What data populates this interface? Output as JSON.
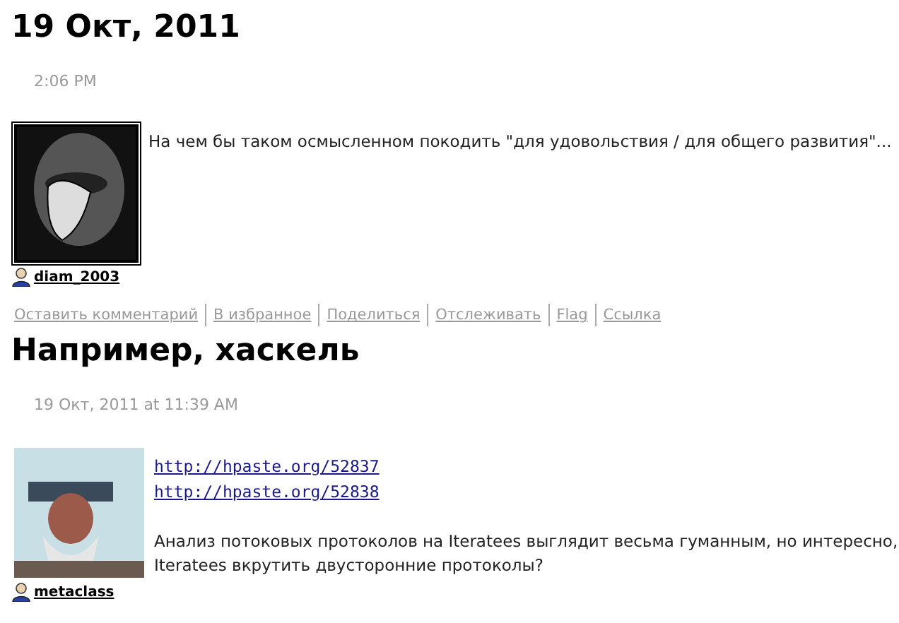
{
  "posts": [
    {
      "title": "19 Окт, 2011",
      "time": "2:06 PM",
      "avatar": {
        "kind": "drawing"
      },
      "author": "diam_2003",
      "body": [
        {
          "kind": "text",
          "lines": [
            "На чем бы таком осмысленном покодить \"для удовольствия / для общего развития\"..."
          ]
        }
      ],
      "actions": [
        "Оставить комментарий",
        "В избранное",
        "Поделиться",
        "Отслеживать",
        "Flag",
        "Ссылка"
      ]
    },
    {
      "title": "Например, хаскель",
      "time": "19 Окт, 2011 at 11:39 AM",
      "avatar": {
        "kind": "photo"
      },
      "author": "metaclass",
      "body": [
        {
          "kind": "links",
          "lines": [
            "http://hpaste.org/52837",
            "http://hpaste.org/52838"
          ]
        },
        {
          "kind": "text",
          "lines": [
            "Анализ потоковых протоколов на Iteratees выглядит весьма гуманным, но интересно,",
            "Iteratees вкрутить двусторонние протоколы?"
          ]
        }
      ]
    }
  ]
}
